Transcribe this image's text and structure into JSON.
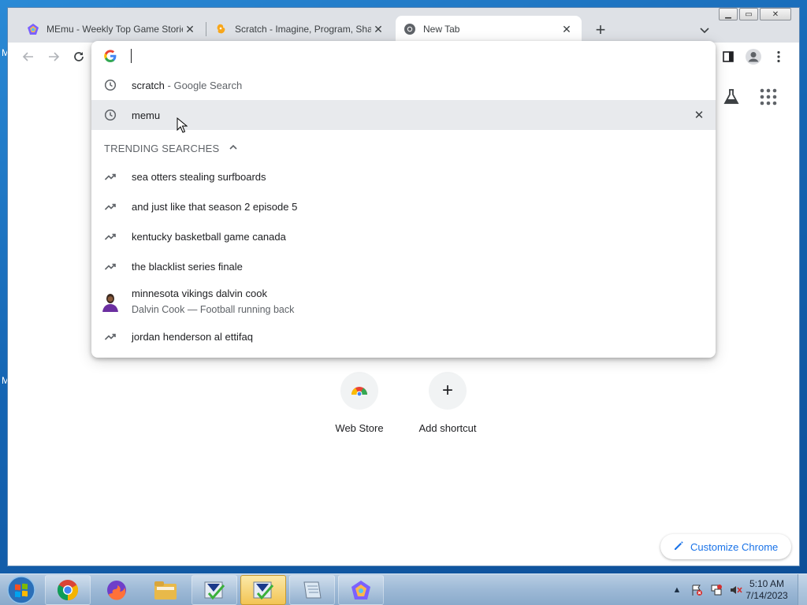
{
  "desktop": {
    "letter_top": "M",
    "letter_mid": "M"
  },
  "browser": {
    "tabs": [
      {
        "title": "MEmu - Weekly Top Game Stories",
        "close": "✕"
      },
      {
        "title": "Scratch - Imagine, Program, Share",
        "close": "✕"
      },
      {
        "title": "New Tab",
        "close": "✕"
      }
    ],
    "window_controls": {
      "minimize": "▁",
      "maximize": "▭",
      "close": "✕"
    },
    "new_tab": "+",
    "omnibox": {
      "input_value": "",
      "history": [
        {
          "text": "scratch",
          "suffix": " - Google Search"
        },
        {
          "text": "memu",
          "remove": "✕"
        }
      ],
      "trending_header": "TRENDING SEARCHES",
      "trending": [
        "sea otters stealing surfboards",
        "and just like that season 2 episode 5",
        "kentucky basketball game canada",
        "the blacklist series finale"
      ],
      "entity": {
        "title": "minnesota vikings dalvin cook",
        "subtitle": "Dalvin Cook — Football running back"
      },
      "trending_last": "jordan henderson al ettifaq"
    },
    "shortcuts": [
      {
        "label": "Web Store"
      },
      {
        "label": "Add shortcut",
        "icon": "+"
      }
    ],
    "customize_label": "Customize Chrome"
  },
  "taskbar": {
    "time": "5:10 AM",
    "date": "7/14/2023",
    "tray_arrow": "▲"
  }
}
